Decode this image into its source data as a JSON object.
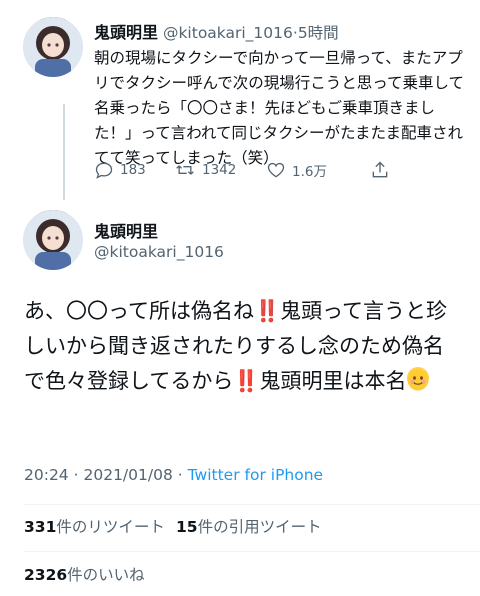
{
  "reply_tweet": {
    "name": "鬼頭明里",
    "handle": "@kitoakari_1016",
    "separator": "·",
    "time": "5時間",
    "text": "朝の現場にタクシーで向かって一旦帰って、またアプリでタクシー呼んで次の現場行こうと思って乗車して名乗ったら「〇〇さま！先ほどもご乗車頂きました！」って言われて同じタクシーがたまたま配車されてて笑ってしまった（笑）",
    "replies": "183",
    "retweets": "1342",
    "likes": "1.6万"
  },
  "main_tweet": {
    "name": "鬼頭明里",
    "handle": "@kitoakari_1016",
    "text_part1": "あ、〇〇って所は偽名ね",
    "text_part2": "鬼頭って言うと珍しいから聞き返されたりするし念のため偽名で色々登録してるから",
    "text_part3": "鬼頭明里は本名",
    "bang_emoji": "‼️",
    "time": "20:24",
    "separator": "·",
    "date": "2021/01/08",
    "source": "Twitter for iPhone",
    "retweet_count": "331",
    "retweet_label": "件のリツイート",
    "quote_count": "15",
    "quote_label": "件の引用ツイート",
    "like_count": "2326",
    "like_label": "件のいいね"
  },
  "icons": [
    "avatar",
    "reply-icon",
    "retweet-icon",
    "like-icon",
    "share-icon",
    "smile-emoji-icon"
  ],
  "colors": {
    "text": "#0f1419",
    "secondary": "#536471",
    "link": "#1d9bf0",
    "emoji_red": "#e0245e"
  }
}
